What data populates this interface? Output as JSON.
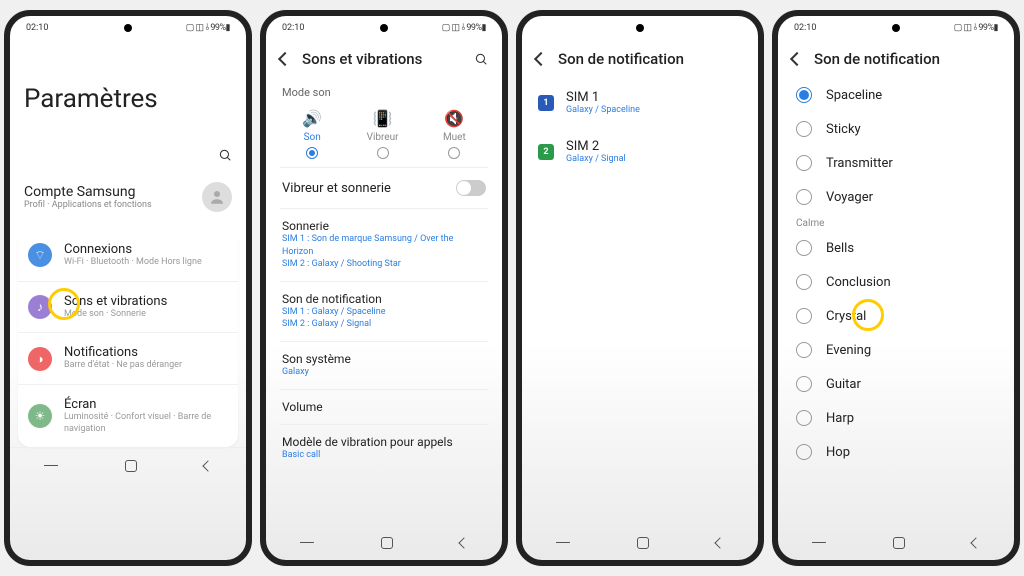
{
  "status": {
    "time": "02:10",
    "indicators": "⌵◃▷",
    "right": "▢ ◫ ⫰ 99%▮"
  },
  "nav": {
    "recent": "|||",
    "home": "○",
    "back": "<"
  },
  "screen1": {
    "title": "Paramètres",
    "account": {
      "title": "Compte Samsung",
      "subtitle": "Profil · Applications et fonctions"
    },
    "items": [
      {
        "title": "Connexions",
        "subtitle": "Wi-Fi · Bluetooth · Mode Hors ligne"
      },
      {
        "title": "Sons et vibrations",
        "subtitle": "Mode son · Sonnerie"
      },
      {
        "title": "Notifications",
        "subtitle": "Barre d'état · Ne pas déranger"
      },
      {
        "title": "Écran",
        "subtitle": "Luminosité · Confort visuel · Barre de navigation"
      }
    ]
  },
  "screen2": {
    "title": "Sons et vibrations",
    "mode_label": "Mode son",
    "modes": [
      {
        "label": "Son",
        "active": true
      },
      {
        "label": "Vibreur",
        "active": false
      },
      {
        "label": "Muet",
        "active": false
      }
    ],
    "toggle": {
      "label": "Vibreur et sonnerie"
    },
    "blocks": [
      {
        "title": "Sonnerie",
        "lines": [
          "SIM 1 : Son de marque Samsung / Over the Horizon",
          "SIM 2 : Galaxy / Shooting Star"
        ]
      },
      {
        "title": "Son de notification",
        "lines": [
          "SIM 1 : Galaxy / Spaceline",
          "SIM 2 : Galaxy / Signal"
        ]
      },
      {
        "title": "Son système",
        "lines": [
          "Galaxy"
        ]
      },
      {
        "title": "Volume",
        "lines": []
      },
      {
        "title": "Modèle de vibration pour appels",
        "lines": [
          "Basic call"
        ]
      }
    ]
  },
  "screen3": {
    "title": "Son de notification",
    "sims": [
      {
        "n": "1",
        "title": "SIM 1",
        "subtitle": "Galaxy / Spaceline"
      },
      {
        "n": "2",
        "title": "SIM 2",
        "subtitle": "Galaxy / Signal"
      }
    ]
  },
  "screen4": {
    "title": "Son de notification",
    "group1": [
      {
        "label": "Spaceline",
        "selected": true
      },
      {
        "label": "Sticky"
      },
      {
        "label": "Transmitter"
      },
      {
        "label": "Voyager"
      }
    ],
    "category": "Calme",
    "group2": [
      {
        "label": "Bells"
      },
      {
        "label": "Conclusion"
      },
      {
        "label": "Crystal",
        "highlight": true
      },
      {
        "label": "Evening"
      },
      {
        "label": "Guitar"
      },
      {
        "label": "Harp"
      },
      {
        "label": "Hop"
      }
    ]
  }
}
